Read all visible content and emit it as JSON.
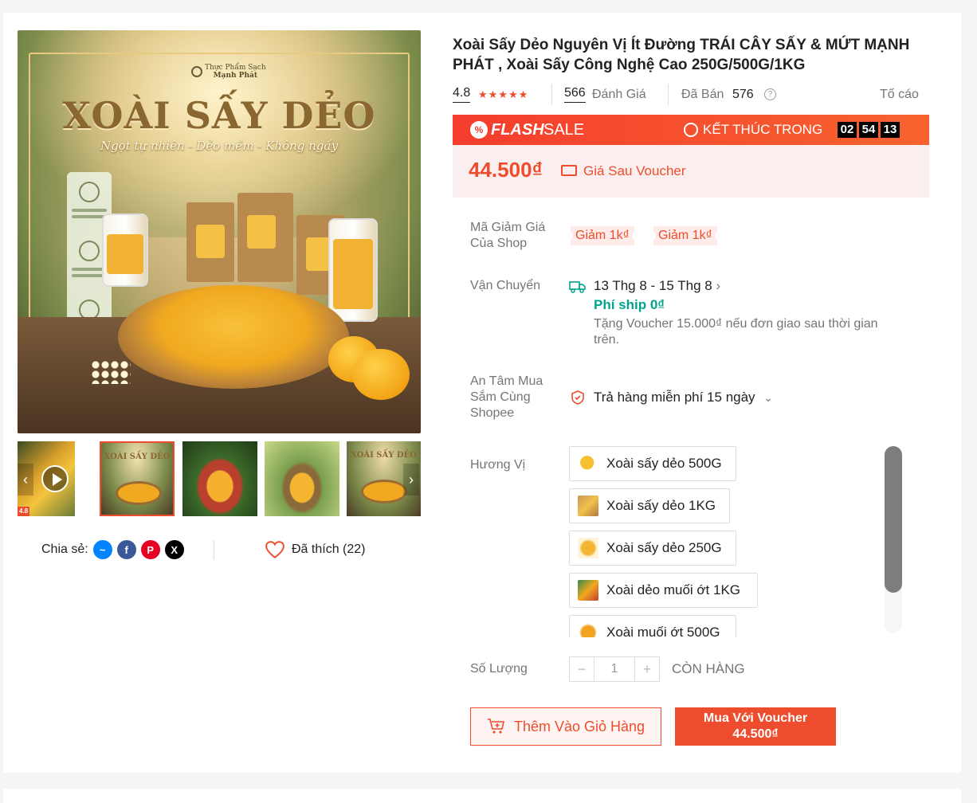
{
  "product": {
    "title": "Xoài Sấy Dẻo Nguyên Vị Ít Đường TRÁI CÂY SẤY & MỨT MẠNH PHÁT , Xoài Sấy Công Nghệ Cao 250G/500G/1KG",
    "rating": "4.8",
    "stars": "★★★★★",
    "review_count": "566",
    "review_label": "Đánh Giá",
    "sold_label": "Đã Bán",
    "sold_count": "576",
    "report_label": "Tố cáo"
  },
  "image": {
    "brand_top": "Thực Phẩm Sạch",
    "brand_name": "Mạnh Phát",
    "headline": "XOÀI SẤY DẺO",
    "tagline": "Ngọt tự nhiên - Dẻo mềm - Không ngấy",
    "thumb_title": "XOÀI SẤY DẺO",
    "thumb_badge": "4.8"
  },
  "flash_sale": {
    "flash_label": "FLASH",
    "sale_label": "SALE",
    "ends_label": "KẾT THÚC TRONG",
    "hours": "02",
    "minutes": "54",
    "seconds": "13"
  },
  "price": {
    "amount": "44.500₫",
    "note": "Giá Sau Voucher"
  },
  "shop_voucher": {
    "label": "Mã Giảm Giá Của Shop",
    "chips": [
      "Giảm 1k₫",
      "Giảm 1k₫"
    ]
  },
  "shipping": {
    "label": "Vận Chuyển",
    "dates": "13 Thg 8 - 15 Thg 8",
    "fee": "Phí ship 0₫",
    "note": "Tặng Voucher 15.000₫ nếu đơn giao sau thời gian trên."
  },
  "guarantee": {
    "label": "An Tâm Mua Sắm Cùng Shopee",
    "value": "Trả hàng miễn phí 15 ngày"
  },
  "flavor": {
    "label": "Hương Vị",
    "options": [
      "Xoài sấy dẻo 500G",
      "Xoài sấy dẻo 1KG",
      "Xoài sấy dẻo 250G",
      "Xoài dẻo muối ớt 1KG",
      "Xoài muối ớt 500G"
    ]
  },
  "quantity": {
    "label": "Số Lượng",
    "value": "1",
    "minus": "−",
    "plus": "+",
    "stock": "CÒN HÀNG"
  },
  "actions": {
    "add_to_cart": "Thêm Vào Giỏ Hàng",
    "buy_line1": "Mua Với Voucher",
    "buy_line2": "44.500₫"
  },
  "share": {
    "label": "Chia sẻ:",
    "liked": "Đã thích (22)"
  },
  "colors": {
    "accent": "#ee4d2d",
    "teal": "#00a48c"
  }
}
